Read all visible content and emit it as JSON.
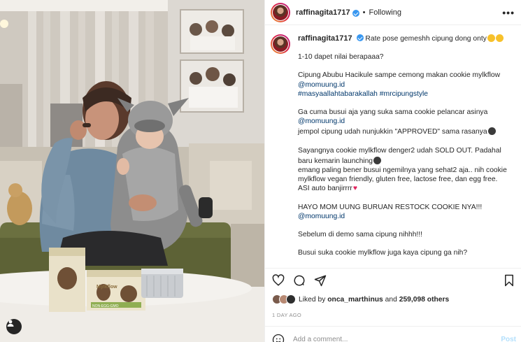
{
  "post": {
    "username": "raffinagita1717",
    "separator": "•",
    "follow_label": "Following",
    "more_label": "•••"
  },
  "caption": {
    "username": "raffinagita1717",
    "line1": "Rate pose gemeshh cipung dong onty",
    "p2": "1-10 dapet nilai berapaaa?",
    "p3a": "Cipung Abubu Hacikule sampe cemong makan cookie mylkflow",
    "p3b": "@momuung.id",
    "p3c": "#masyaallahtabarakallah #mrcipungstyle",
    "p4a": "Ga cuma busui aja yang suka sama cookie pelancar asinya",
    "p4b": "@momuung.id",
    "p4c": "jempol cipung udah nunjukkin \"APPROVED\" sama rasanya",
    "p5a": "Sayangnya cookie mylkflow denger2 udah SOLD OUT. Padahal baru kemarin launching",
    "p5b": "emang paling bener busui ngemilnya yang sehat2 aja.. nih cookie mylkflow vegan friendly, gluten free, lactose free, dan egg free. ASI auto banjirrrr",
    "p6a": "HAYO MOM UUNG BURUAN RESTOCK COOKIE NYA!!!",
    "p6b": "@momuung.id",
    "p7": "Sebelum di demo sama cipung nihhh!!!",
    "p8": "Busui suka cookie mylkflow juga kaya cipung ga nih?"
  },
  "engagement": {
    "liked_by_prefix": "Liked by",
    "liked_by_user": "onca_marthinus",
    "and_label": "and",
    "others_count": "259,098 others",
    "timestamp": "1 DAY AGO"
  },
  "comment": {
    "placeholder": "Add a comment...",
    "post_label": "Post"
  },
  "photo": {
    "box_brand": "Mylkflow",
    "box_flavor": "NON-EGG-GMO"
  },
  "icons": [
    "verified-badge-icon",
    "more-options-icon",
    "heart-icon",
    "comment-icon",
    "share-icon",
    "bookmark-icon",
    "user-tag-icon",
    "emoji-icon"
  ],
  "colors": {
    "link": "#00376b",
    "verified": "#3897f0",
    "secondary_text": "#8e8e8e"
  }
}
